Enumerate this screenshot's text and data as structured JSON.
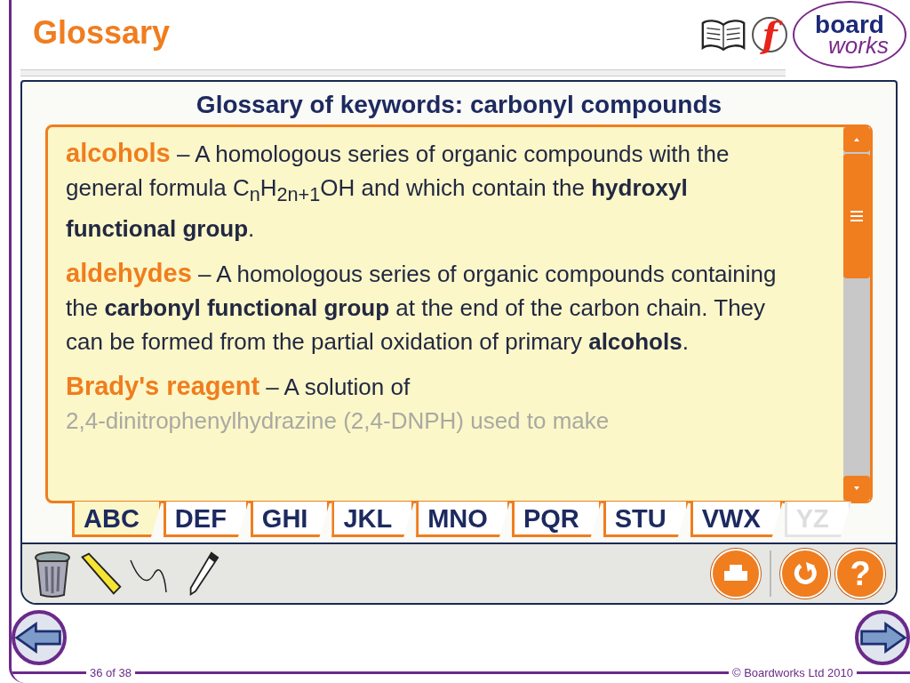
{
  "header": {
    "title": "Glossary",
    "flash_letter": "f",
    "logo_top": "board",
    "logo_bottom": "works"
  },
  "glossary": {
    "heading": "Glossary of keywords: carbonyl compounds",
    "entries": [
      {
        "term": "alcohols",
        "definition": "– A homologous series of organic compounds with the general formula C$_{n}$H$_{2n+1}$OH and which contain the **hydroxyl functional group**."
      },
      {
        "term": "aldehydes",
        "definition": "– A homologous series of organic compounds containing the **carbonyl functional group** at the end of the carbon chain. They can be formed from the partial oxidation of primary **alcohols**."
      },
      {
        "term": "Brady's reagent",
        "definition": "– A solution of",
        "faded_text": "2,4-dinitrophenylhydrazine (2,4-DNPH) used to make"
      }
    ],
    "tabs": [
      {
        "label": "ABC",
        "selected": true,
        "disabled": false
      },
      {
        "label": "DEF",
        "selected": false,
        "disabled": false
      },
      {
        "label": "GHI",
        "selected": false,
        "disabled": false
      },
      {
        "label": "JKL",
        "selected": false,
        "disabled": false
      },
      {
        "label": "MNO",
        "selected": false,
        "disabled": false
      },
      {
        "label": "PQR",
        "selected": false,
        "disabled": false
      },
      {
        "label": "STU",
        "selected": false,
        "disabled": false
      },
      {
        "label": "VWX",
        "selected": false,
        "disabled": false
      },
      {
        "label": "YZ",
        "selected": false,
        "disabled": true
      }
    ]
  },
  "toolbar": {
    "help_label": "?"
  },
  "footer": {
    "page": "36 of 38",
    "copyright": "© Boardworks Ltd 2010"
  }
}
